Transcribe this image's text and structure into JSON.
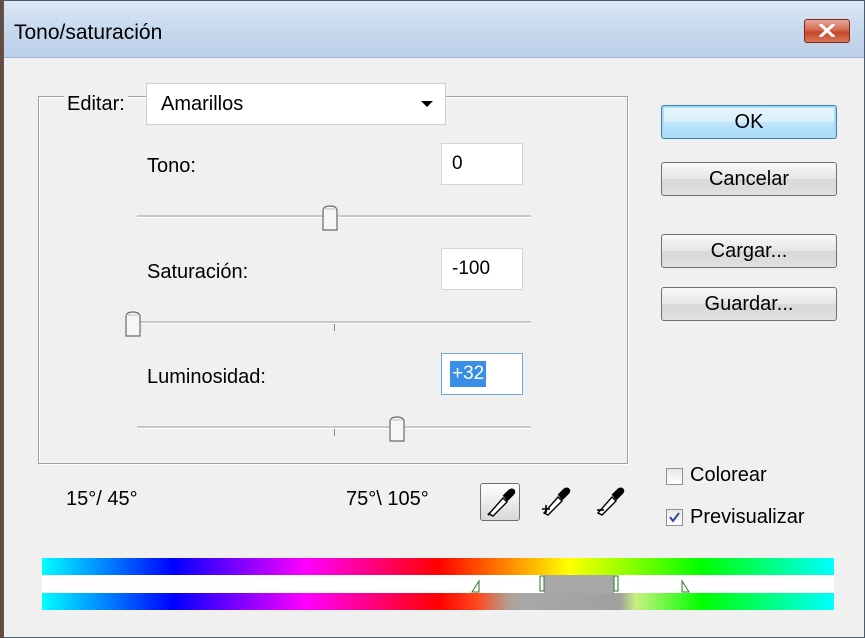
{
  "window": {
    "title": "Tono/saturación"
  },
  "edit": {
    "label": "Editar:",
    "selected": "Amarillos"
  },
  "hue": {
    "label": "Tono:",
    "value": "0",
    "slider_fraction": 0.5
  },
  "saturation": {
    "label": "Saturación:",
    "value": "-100",
    "slider_fraction": 0.0
  },
  "lightness": {
    "label": "Luminosidad:",
    "value": "+32",
    "slider_fraction": 0.66
  },
  "buttons": {
    "ok": "OK",
    "cancel": "Cancelar",
    "load": "Cargar...",
    "save": "Guardar..."
  },
  "options": {
    "colorize_label": "Colorear",
    "colorize_checked": false,
    "preview_label": "Previsualizar",
    "preview_checked": true
  },
  "range": {
    "left": "15°/ 45°",
    "right": "75°\\ 105°"
  },
  "icons": [
    "close-icon",
    "eyedropper-icon",
    "eyedropper-plus-icon",
    "eyedropper-minus-icon",
    "chevron-down-icon"
  ]
}
